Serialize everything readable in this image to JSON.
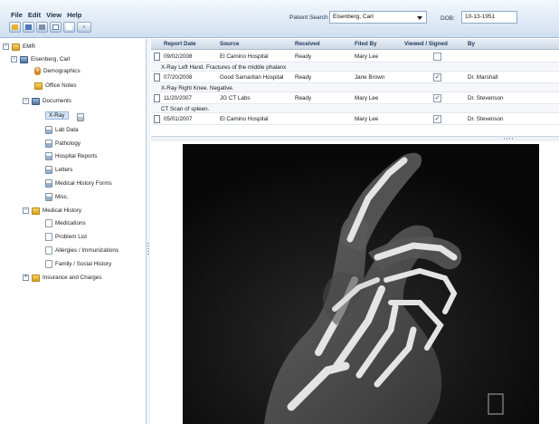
{
  "menu": [
    "File",
    "Edit",
    "View",
    "Help"
  ],
  "toolbar_more_label": "»",
  "patient_search": {
    "label": "Patient Search",
    "value": "Eisenberg, Carl"
  },
  "dob": {
    "label": "DOB:",
    "value": "10-13-1951"
  },
  "tree": {
    "root": "EMR",
    "patient": "Eisenberg, Carl",
    "demographics": "Demographics",
    "office_notes": "Office Notes",
    "documents": "Documents",
    "xray": "X-Ray",
    "lab_data": "Lab Data",
    "pathology": "Pathology",
    "hospital_reports": "Hospital Reports",
    "letters": "Letters",
    "medical_history_forms": "Medical History Forms",
    "misc": "Misc.",
    "medical_history": "Medical History",
    "medications": "Medications",
    "problem_list": "Problem List",
    "allergies": "Allergies / Immunizations",
    "family_social": "Family / Social History",
    "insurance": "Insurance and Charges"
  },
  "grid": {
    "headers": [
      "Report Date",
      "Source",
      "Received",
      "Filed By",
      "Viewed / Signed",
      "By"
    ],
    "rows": [
      {
        "date": "09/02/2008",
        "source": "El Camino Hospital",
        "received": "Ready",
        "filed_by": "Mary Lee",
        "signed": false,
        "by": "",
        "note": "X-Ray Left Hand. Fractures of the middle phalanx"
      },
      {
        "date": "07/20/2008",
        "source": "Good Samaritan Hospital",
        "received": "Ready",
        "filed_by": "Jane Brown",
        "signed": true,
        "by": "Dr. Marshall",
        "note": "X-Ray Right Knee. Negative."
      },
      {
        "date": "11/20/2007",
        "source": "JG CT Labs",
        "received": "Ready",
        "filed_by": "Mary Lee",
        "signed": true,
        "by": "Dr. Stevenson",
        "note": "CT Scan of spleen."
      },
      {
        "date": "05/01/2007",
        "source": "El Camino Hospital",
        "received": "",
        "filed_by": "Mary Lee",
        "signed": true,
        "by": "Dr. Stevenson",
        "note": ""
      }
    ],
    "check_mark": "✓"
  },
  "colors": {
    "toolbar_bg": "#cfdff0",
    "header_text": "#233a5c",
    "selected": "#d7e6f7",
    "xray_bg": "#0e0e0e"
  },
  "icons": [
    "folder-icon",
    "save-icon",
    "print-icon",
    "document-icon",
    "new-icon",
    "person-icon",
    "user-icon",
    "documents-icon",
    "page-icon",
    "report-icon",
    "xray-icon",
    "checkbox-icon"
  ]
}
